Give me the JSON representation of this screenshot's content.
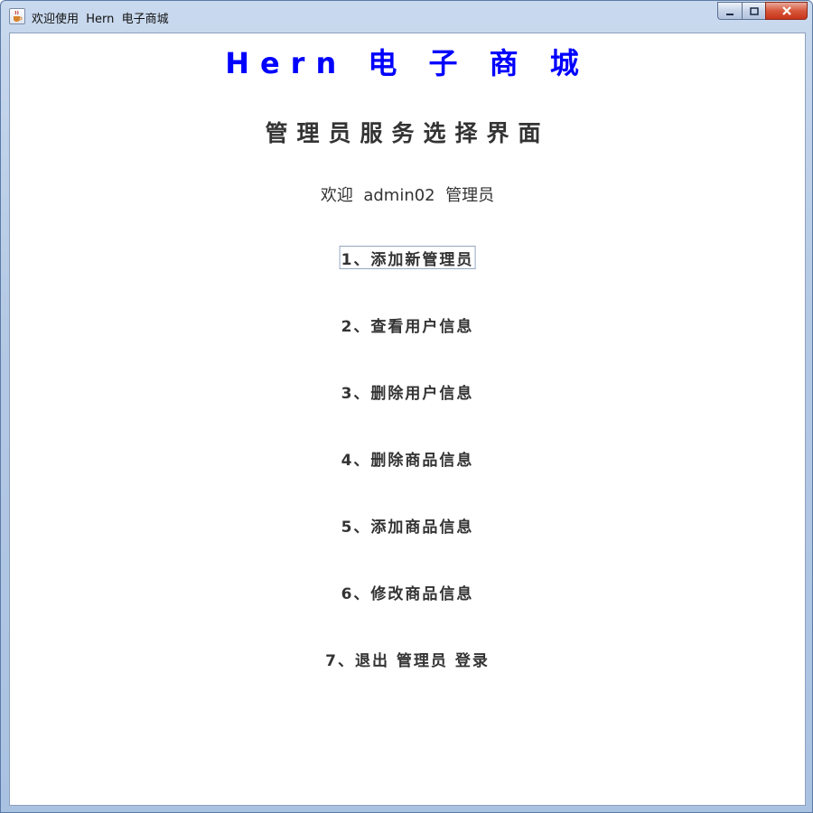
{
  "window": {
    "title": "欢迎使用  Hern  电子商城"
  },
  "header": {
    "brand": "Hern 电 子 商 城",
    "subtitle": "管理员服务选择界面",
    "welcome": "欢迎  admin02  管理员"
  },
  "menu": {
    "items": [
      {
        "label": "1、添加新管理员"
      },
      {
        "label": "2、查看用户信息"
      },
      {
        "label": "3、删除用户信息"
      },
      {
        "label": "4、删除商品信息"
      },
      {
        "label": "5、添加商品信息"
      },
      {
        "label": "6、修改商品信息"
      },
      {
        "label": "7、退出 管理员 登录"
      }
    ]
  },
  "colors": {
    "brand": "#0000ff",
    "text": "#333333"
  },
  "icons": {
    "app": "java-coffee-cup-icon",
    "minimize": "minimize-icon",
    "maximize": "maximize-icon",
    "close": "close-icon"
  }
}
